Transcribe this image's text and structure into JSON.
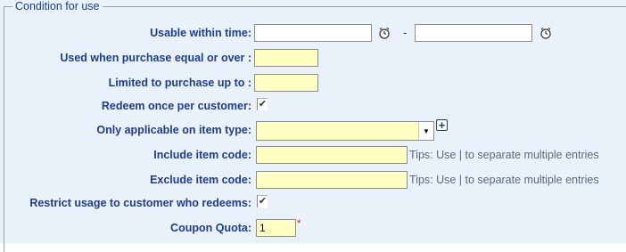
{
  "section": {
    "legend": "Condition for use"
  },
  "usable_within_time": {
    "label": "Usable within time:",
    "start_value": "",
    "end_value": "",
    "separator": "-"
  },
  "purchase_min": {
    "label": "Used when purchase equal or over :",
    "value": ""
  },
  "purchase_limit": {
    "label": "Limited to purchase up to :",
    "value": ""
  },
  "redeem_once": {
    "label": "Redeem once per customer:",
    "checked": true,
    "checkmark": "✔"
  },
  "item_type": {
    "label": "Only applicable on item type:",
    "selected": "",
    "add_symbol": "+"
  },
  "include_item": {
    "label": "Include item code:",
    "value": "",
    "tips": "Tips: Use | to separate multiple entries"
  },
  "exclude_item": {
    "label": "Exclude item code:",
    "value": "",
    "tips": "Tips: Use | to separate multiple entries"
  },
  "restrict_usage": {
    "label": "Restrict usage to customer who redeems:",
    "checked": true,
    "checkmark": "✔"
  },
  "coupon_quota": {
    "label": "Coupon Quota:",
    "value": "1",
    "required_marker": "*"
  }
}
